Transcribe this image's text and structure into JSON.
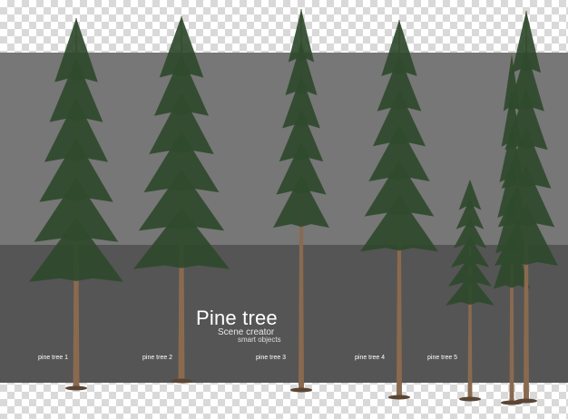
{
  "title": "Pine tree",
  "subtitle": "Scene creator",
  "tagline": "smart objects",
  "tree_labels": [
    "pine tree 1",
    "pine tree 2",
    "pine tree 3",
    "pine tree 4",
    "pine tree 5"
  ],
  "colors": {
    "backdrop_top": "#777777",
    "backdrop_bottom": "#555555",
    "trunk": "#8a6a4f",
    "foliage": "#2f4a2c",
    "text": "#ffffff"
  }
}
